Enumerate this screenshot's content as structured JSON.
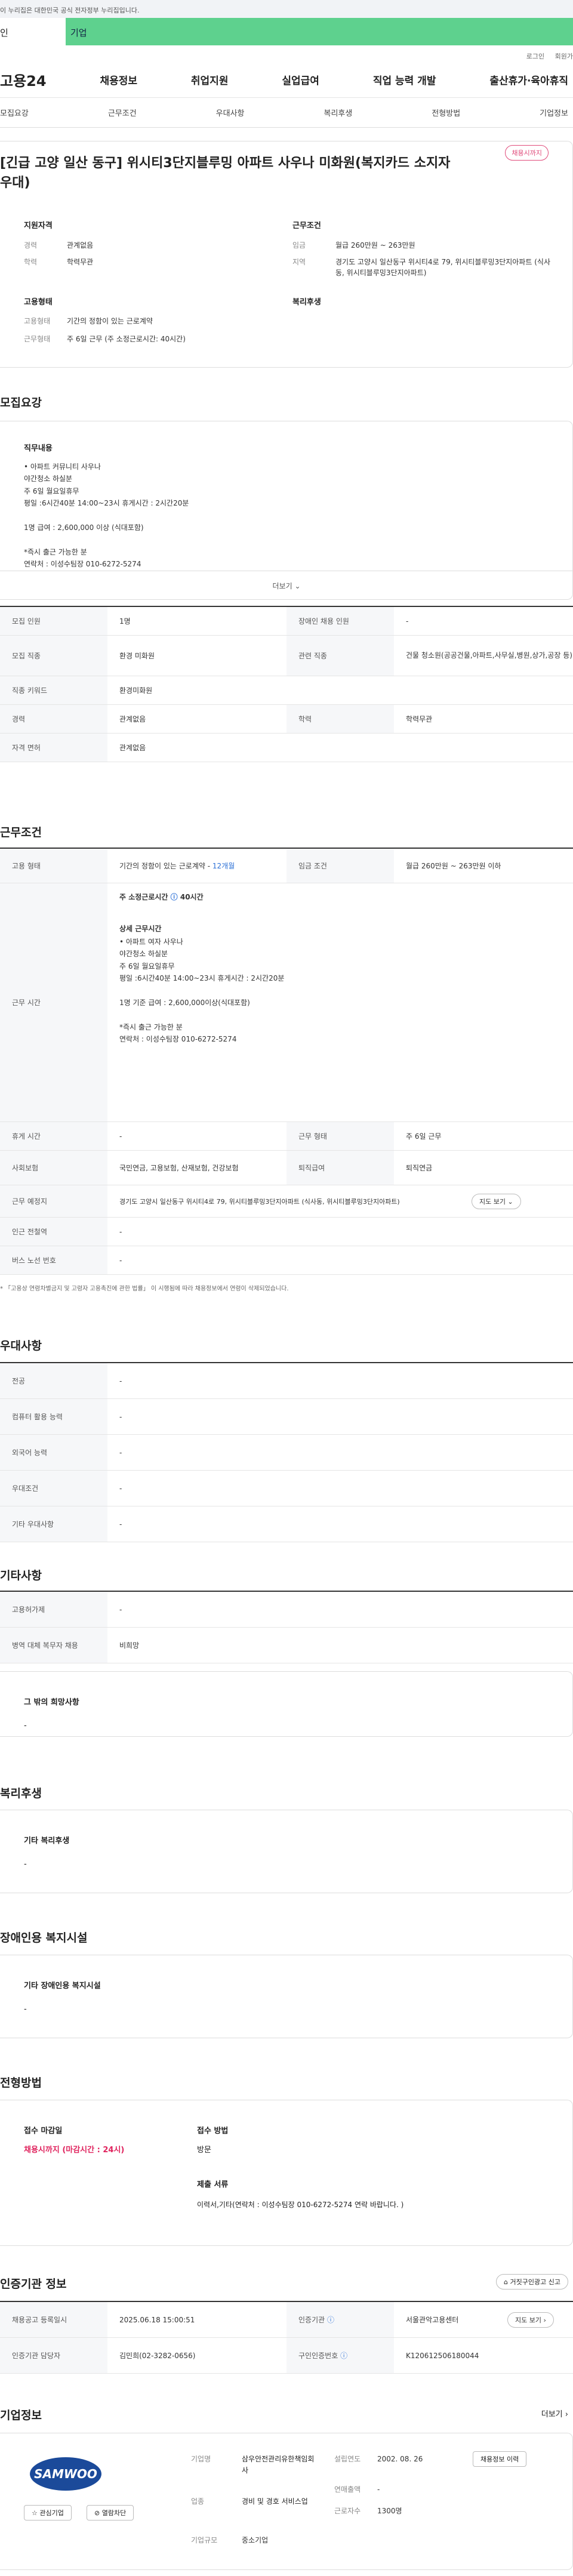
{
  "gov_banner": "이 누리집은 대한민국 공식 전자정부 누리집입니다.",
  "tabs": [
    "인",
    "기업"
  ],
  "util": [
    "로그인",
    "회원가"
  ],
  "gnb": {
    "logo": "고용24",
    "menu": [
      "채용정보",
      "취업지원",
      "실업급여",
      "직업 능력 개발",
      "출산휴가·육아휴직"
    ]
  },
  "anchors": [
    "모집요강",
    "근무조건",
    "우대사항",
    "복리후생",
    "전형방법",
    "기업정보"
  ],
  "hero": {
    "title": "[긴급 고양 일산 동구] 위시티3단지블루밍 아파트 사우나 미화원(복지카드 소지자 우대)",
    "badge": "채용시까지",
    "qual_h": "지원자격",
    "qual": [
      [
        "경력",
        "관계없음"
      ],
      [
        "학력",
        "학력무관"
      ]
    ],
    "cond_h": "근무조건",
    "cond": [
      [
        "임금",
        "월급 260만원 ~ 263만원"
      ],
      [
        "지역",
        "경기도 고양시 일산동구 위시티4로 79, 위시티블루밍3단지아파트 (식사동, 위시티블루밍3단지아파트)"
      ]
    ],
    "emp_h": "고용형태",
    "emp": [
      [
        "고용형태",
        "기간의 정함이 있는 근로계약"
      ],
      [
        "근무형태",
        "주 6일 근무 (주 소정근로시간: 40시간)"
      ]
    ],
    "wel_h": "복리후생"
  },
  "recruit": {
    "title": "모집요강",
    "duty_h": "직무내용",
    "duty": "• 아파트 커뮤니티 사우나\n   야간청소 하실분\n  주 6일  월요일휴무\n  평일 :6시간40분  14:00~23시   휴게시간 : 2시간20분\n\n1명  급여 : 2,600,000 이상 (식대포함)\n\n*즉시 출근 가능한 분\n연락처 : 이성수팀장 010-6272-5274",
    "more": "더보기",
    "rows": [
      [
        "모집 인원",
        "1명",
        "장애인 채용 인원",
        "-"
      ],
      [
        "모집 직종",
        "환경 미화원",
        "관련 직종",
        "건물 청소원(공공건물,아파트,사무실,병원,상가,공장 등)"
      ],
      [
        "직종 키워드",
        "환경미화원"
      ],
      [
        "경력",
        "관계없음",
        "학력",
        "학력무관"
      ],
      [
        "자격 면허",
        "관계없음"
      ]
    ]
  },
  "work": {
    "title": "근무조건",
    "type_k": "고용 형태",
    "type_v": "기간의 정함이 있는 근로계약",
    "type_term": "12개월",
    "wage_k": "임금 조건",
    "wage_v": "월급 260만원 ~ 263만원 이하",
    "time_k": "근무 시간",
    "time_hours": "주 소정근로시간",
    "time_hours_v": "40시간",
    "time_detail_h": "상세 근무시간",
    "time_detail": "• 아파트 여자 사우나\n   야간청소 하실분\n  주 6일   월요일휴무\n  평일 :6시간40분  14:00~23시   휴게시간 : 2시간20분\n\n1명 기준 급여 : 2,600,000이상(식대포함)\n\n*즉시 출근 가능한 분\n연락처 : 이성수팀장 010-6272-5274",
    "rest_k": "휴게 시간",
    "rest_v": "-",
    "form_k": "근무 형태",
    "form_v": "주 6일 근무",
    "ins_k": "사회보험",
    "ins_v": "국민연금, 고용보험, 산재보험, 건강보험",
    "ret_k": "퇴직급여",
    "ret_v": "퇴직연금",
    "place_k": "근무 예정지",
    "place_v": "경기도 고양시 일산동구 위시티4로 79, 위시티블루밍3단지아파트 (식사동, 위시티블루밍3단지아파트)",
    "map_btn": "지도 보기",
    "sub_k": "인근 전철역",
    "sub_v": "-",
    "bus_k": "버스 노선 번호",
    "bus_v": "-",
    "note": "* 「고용상 연령차별금지 및 고령자 고용촉진에 관한 법률」 이 시행됨에 따라 채용정보에서 연령이 삭제되었습니다."
  },
  "pref": {
    "title": "우대사항",
    "rows": [
      [
        "전공",
        "-"
      ],
      [
        "컴퓨터 활용 능력",
        "-"
      ],
      [
        "외국어 능력",
        "-"
      ],
      [
        "우대조건",
        "-"
      ],
      [
        "기타 우대사항",
        "-"
      ]
    ]
  },
  "etc": {
    "title": "기타사항",
    "rows": [
      [
        "고용허가제",
        "-"
      ],
      [
        "병역 대체 복무자 채용",
        "비희망"
      ]
    ],
    "wish_h": "그 밖의 희망사항",
    "wish_v": "-"
  },
  "welfare": {
    "title": "복리후생",
    "h": "기타 복리후생",
    "v": "-"
  },
  "disabled": {
    "title": "장애인용 복지시설",
    "h": "기타 장애인용 복지시설",
    "v": "-"
  },
  "proc": {
    "title": "전형방법",
    "deadline_h": "접수 마감일",
    "deadline_v": "채용시까지 (마감시간 : 24시)",
    "method_h": "접수 방법",
    "method_v": "방문",
    "doc_h": "제출 서류",
    "doc_v": "이력서,기타(연락처 : 이성수팀장 010-6272-5274 연락 바랍니다. )"
  },
  "agency": {
    "title": "인증기관 정보",
    "report_btn": "거짓구인광고 신고",
    "rows": [
      [
        "채용공고 등록일시",
        "2025.06.18 15:00:51",
        "인증기관",
        "서울관악고용센터"
      ],
      [
        "인증기관 담당자",
        "김민희(02-3282-0656)",
        "구인인증번호",
        "K120612506180044"
      ]
    ],
    "map_btn": "지도 보기"
  },
  "company": {
    "title": "기업정보",
    "more": "더보기",
    "logo": "SAMWOO",
    "fav": "관심기업",
    "block": "열람차단",
    "name_k": "기업명",
    "name_v": "삼우안전관리유한책임회사",
    "year_k": "설립연도",
    "year_v": "2002. 08. 26",
    "info_btn": "채용정보 이력",
    "ind_k": "업종",
    "ind_v": "경비 및 경호 서비스업",
    "sales_k": "연매출액",
    "sales_v": "-",
    "emp_k": "근로자수",
    "emp_v": "1300명",
    "size_k": "기업규모",
    "size_v": "중소기업"
  },
  "colors": {
    "accent_green": "#5ed18e",
    "badge_pink": "#e04a7a",
    "deadline_red": "#e0245e",
    "link_blue": "#2a6fd6"
  }
}
